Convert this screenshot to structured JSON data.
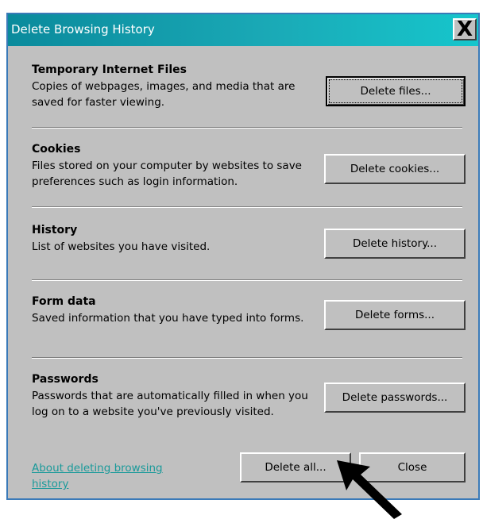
{
  "window": {
    "title": "Delete Browsing History",
    "close_glyph": "X"
  },
  "sections": [
    {
      "title": "Temporary Internet Files",
      "description": "Copies of webpages, images, and media that are saved for faster viewing.",
      "button": "Delete files..."
    },
    {
      "title": "Cookies",
      "description": "Files stored on your computer by websites to save preferences such as login information.",
      "button": "Delete cookies..."
    },
    {
      "title": "History",
      "description": "List of websites you have visited.",
      "button": "Delete history..."
    },
    {
      "title": "Form data",
      "description": "Saved information that you have typed into forms.",
      "button": "Delete forms..."
    },
    {
      "title": "Passwords",
      "description": "Passwords that are automatically filled in when you log on to a website you've previously visited.",
      "button": "Delete passwords..."
    }
  ],
  "footer": {
    "link": "About deleting browsing history",
    "delete_all": "Delete all...",
    "close": "Close"
  },
  "colors": {
    "title_gradient_start": "#0a8a9c",
    "title_gradient_end": "#16c6cc",
    "dialog_bg": "#c0c0c0",
    "link": "#1a9a9a"
  },
  "icons": {
    "pointer": "arrow-pointer-icon"
  }
}
